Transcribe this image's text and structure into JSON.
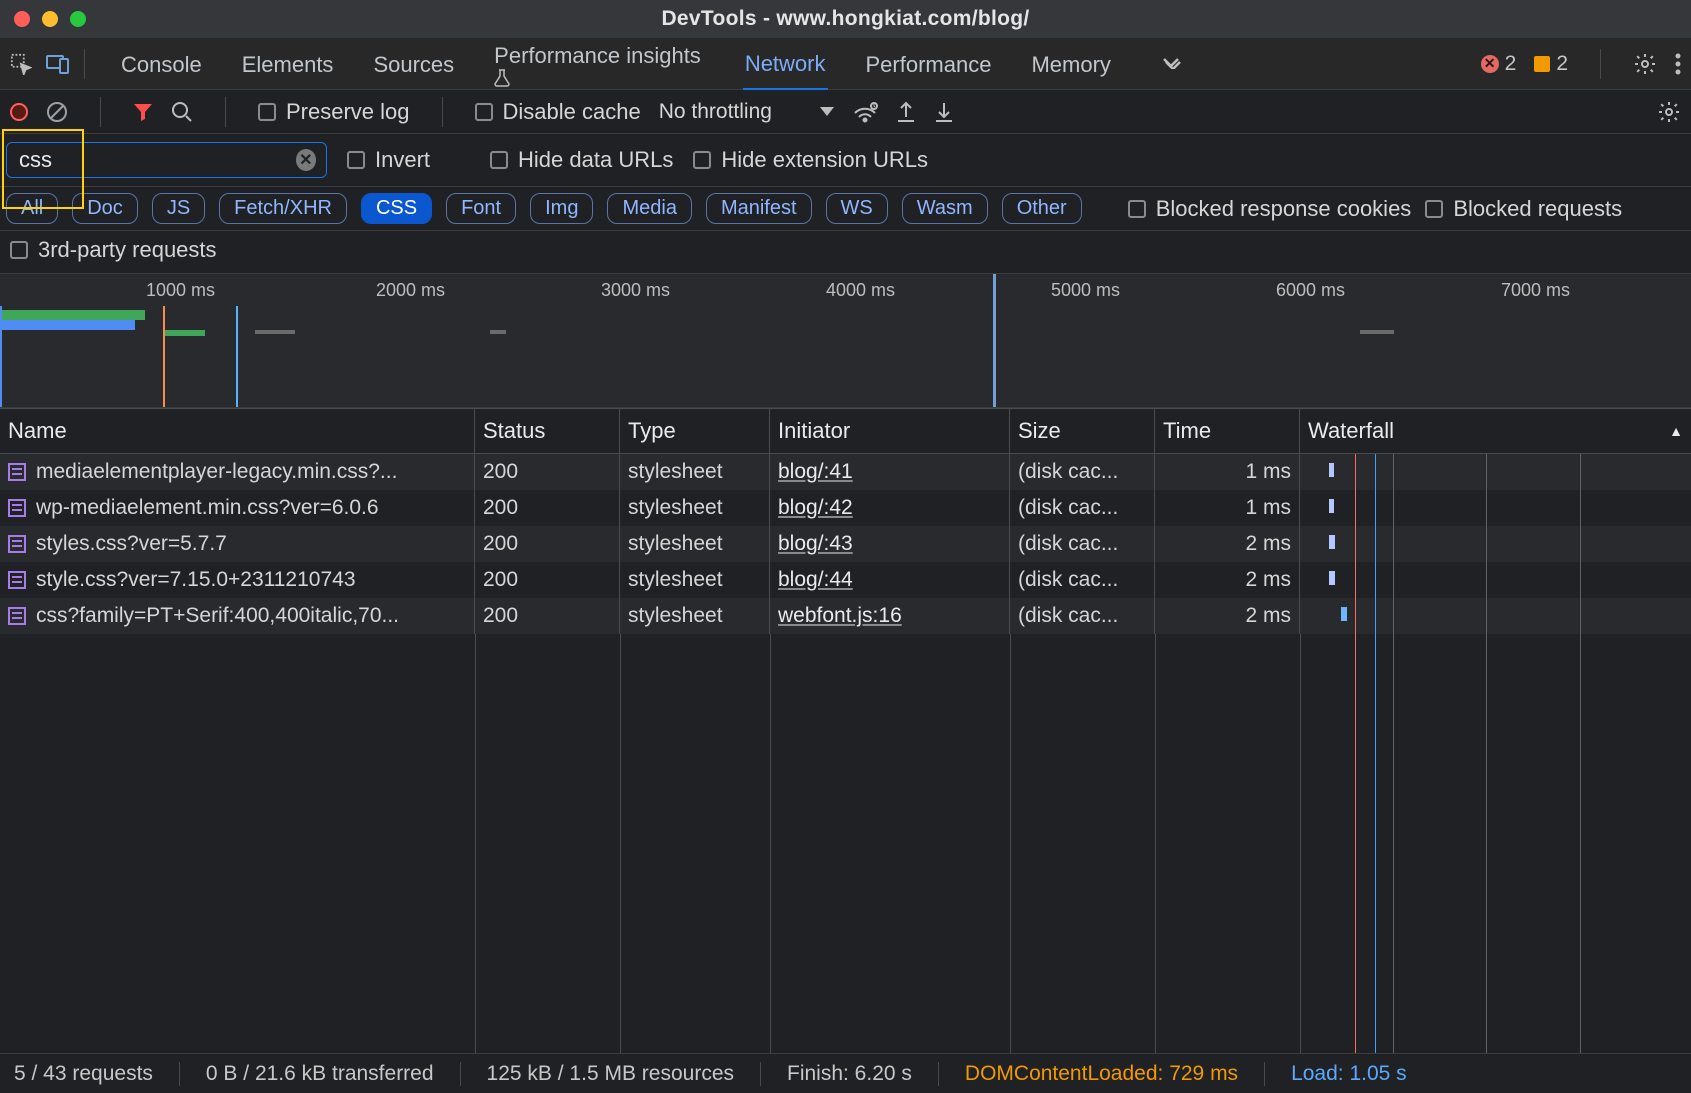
{
  "windowTitle": "DevTools - www.hongkiat.com/blog/",
  "tabs": [
    "Console",
    "Elements",
    "Sources",
    "Performance insights",
    "Network",
    "Performance",
    "Memory"
  ],
  "activeTab": "Network",
  "errors": {
    "count": "2"
  },
  "warnings": {
    "count": "2"
  },
  "toolbar": {
    "preserveLog": "Preserve log",
    "disableCache": "Disable cache",
    "throttling": "No throttling"
  },
  "filter": {
    "value": "css",
    "invert": "Invert",
    "hideDataUrls": "Hide data URLs",
    "hideExtUrls": "Hide extension URLs"
  },
  "chips": [
    "All",
    "Doc",
    "JS",
    "Fetch/XHR",
    "CSS",
    "Font",
    "Img",
    "Media",
    "Manifest",
    "WS",
    "Wasm",
    "Other"
  ],
  "activeChip": "CSS",
  "blockedResponseCookies": "Blocked response cookies",
  "blockedRequests": "Blocked requests",
  "thirdParty": "3rd-party requests",
  "timelineTicks": [
    "1000 ms",
    "2000 ms",
    "3000 ms",
    "4000 ms",
    "5000 ms",
    "6000 ms",
    "7000 ms"
  ],
  "columns": [
    "Name",
    "Status",
    "Type",
    "Initiator",
    "Size",
    "Time",
    "Waterfall"
  ],
  "rows": [
    {
      "name": "mediaelementplayer-legacy.min.css?...",
      "status": "200",
      "type": "stylesheet",
      "initiator": "blog/:41",
      "size": "(disk cac...",
      "time": "1 ms"
    },
    {
      "name": "wp-mediaelement.min.css?ver=6.0.6",
      "status": "200",
      "type": "stylesheet",
      "initiator": "blog/:42",
      "size": "(disk cac...",
      "time": "1 ms"
    },
    {
      "name": "styles.css?ver=5.7.7",
      "status": "200",
      "type": "stylesheet",
      "initiator": "blog/:43",
      "size": "(disk cac...",
      "time": "2 ms"
    },
    {
      "name": "style.css?ver=7.15.0+2311210743",
      "status": "200",
      "type": "stylesheet",
      "initiator": "blog/:44",
      "size": "(disk cac...",
      "time": "2 ms"
    },
    {
      "name": "css?family=PT+Serif:400,400italic,70...",
      "status": "200",
      "type": "stylesheet",
      "initiator": "webfont.js:16",
      "size": "(disk cac...",
      "time": "2 ms"
    }
  ],
  "status": {
    "requests": "5 / 43 requests",
    "transferred": "0 B / 21.6 kB transferred",
    "resources": "125 kB / 1.5 MB resources",
    "finish": "Finish: 6.20 s",
    "dcl": "DOMContentLoaded: 729 ms",
    "load": "Load: 1.05 s"
  }
}
